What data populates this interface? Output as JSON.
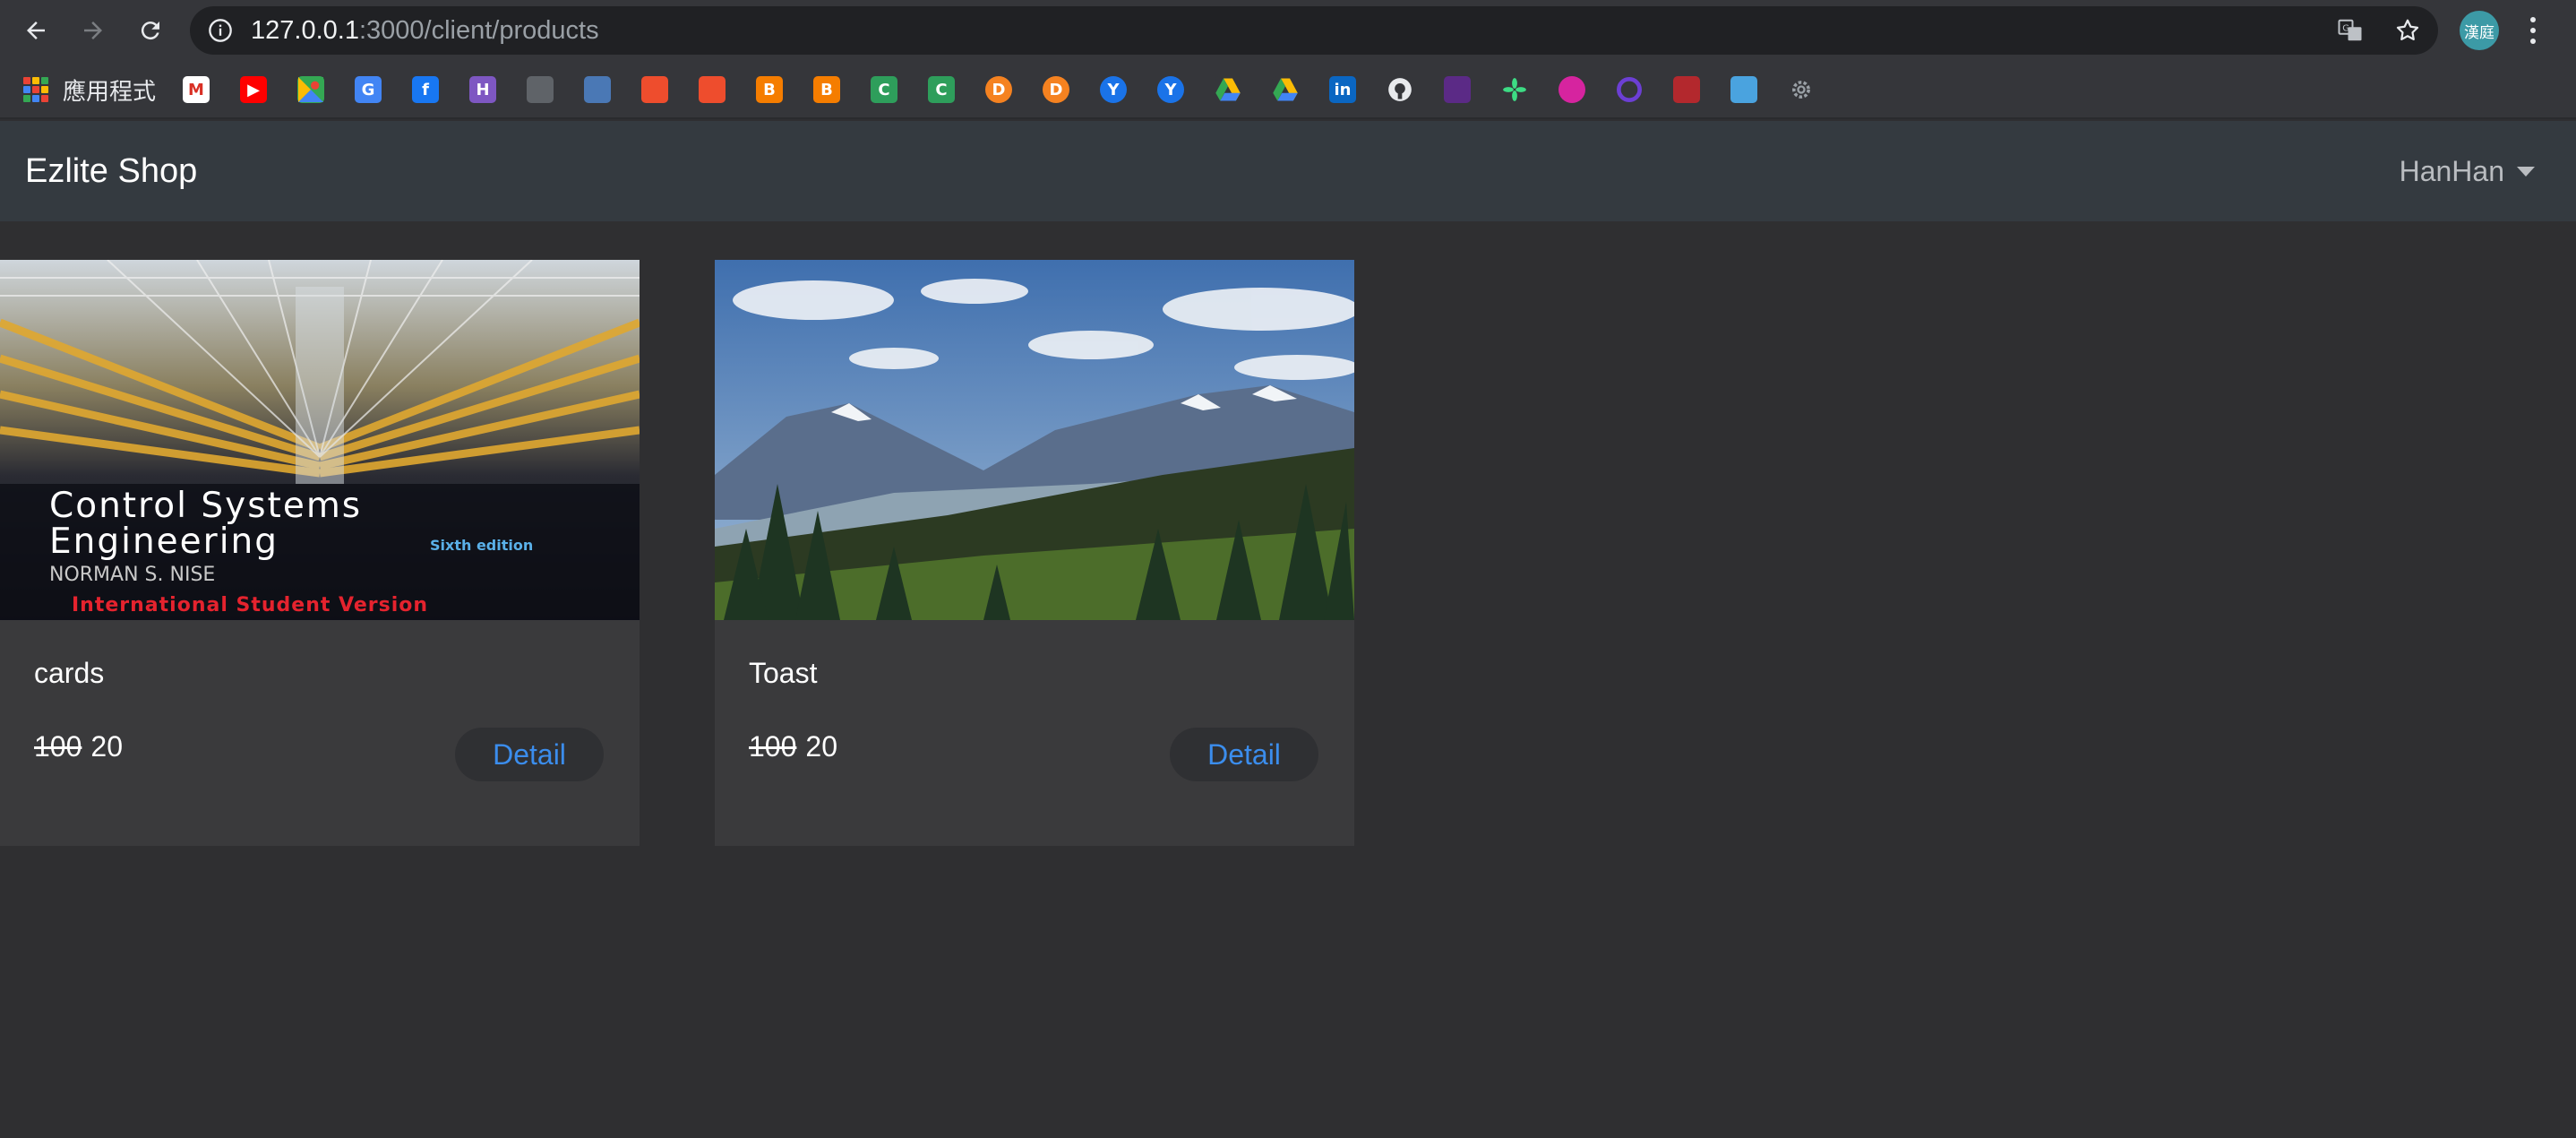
{
  "browser": {
    "url_host": "127.0.0.1",
    "url_path": ":3000/client/products",
    "profile_initials": "漢庭",
    "apps_label": "應用程式",
    "bookmarks": [
      {
        "icon": "gmail-icon",
        "color": "#ffffff",
        "letter": "M",
        "fg": "#d93025"
      },
      {
        "icon": "youtube-icon",
        "color": "#ff0000",
        "letter": "▶",
        "fg": "#ffffff"
      },
      {
        "icon": "google-maps-icon",
        "color": "#34a853",
        "letter": "",
        "fg": "#ffffff"
      },
      {
        "icon": "google-translate-icon",
        "color": "#4285f4",
        "letter": "G",
        "fg": "#ffffff"
      },
      {
        "icon": "facebook-icon",
        "color": "#1877f2",
        "letter": "f",
        "fg": "#ffffff"
      },
      {
        "icon": "hackmd-icon",
        "color": "#7e57c2",
        "letter": "H",
        "fg": "#ffffff"
      },
      {
        "icon": "tool-icon",
        "color": "#5f6368",
        "letter": "",
        "fg": "#ffffff"
      },
      {
        "icon": "blocked-icon",
        "color": "#4a78b5",
        "letter": "",
        "fg": "#ffffff"
      },
      {
        "icon": "shopee-icon",
        "color": "#ee4d2d",
        "letter": "",
        "fg": "#ffffff"
      },
      {
        "icon": "shopee-icon",
        "color": "#ee4d2d",
        "letter": "",
        "fg": "#ffffff"
      },
      {
        "icon": "blogger-icon",
        "color": "#f57d00",
        "letter": "B",
        "fg": "#ffffff"
      },
      {
        "icon": "blogger-icon",
        "color": "#f57d00",
        "letter": "B",
        "fg": "#ffffff"
      },
      {
        "icon": "c-icon",
        "color": "#2e9e5b",
        "letter": "C",
        "fg": "#ffffff"
      },
      {
        "icon": "c-icon",
        "color": "#2e9e5b",
        "letter": "C",
        "fg": "#ffffff"
      },
      {
        "icon": "orange-round-icon",
        "color": "#f58220",
        "letter": "D",
        "fg": "#ffffff"
      },
      {
        "icon": "orange-round-icon",
        "color": "#f58220",
        "letter": "D",
        "fg": "#ffffff"
      },
      {
        "icon": "blue-round-icon",
        "color": "#1a73e8",
        "letter": "Y",
        "fg": "#ffffff"
      },
      {
        "icon": "blue-round-icon",
        "color": "#1a73e8",
        "letter": "Y",
        "fg": "#ffffff"
      },
      {
        "icon": "google-drive-icon",
        "color": "#35363a",
        "letter": "",
        "fg": "#ffffff"
      },
      {
        "icon": "google-drive-icon",
        "color": "#35363a",
        "letter": "",
        "fg": "#ffffff"
      },
      {
        "icon": "linkedin-icon",
        "color": "#0a66c2",
        "letter": "in",
        "fg": "#ffffff"
      },
      {
        "icon": "github-icon",
        "color": "#35363a",
        "letter": "",
        "fg": "#ffffff"
      },
      {
        "icon": "purple-app-icon",
        "color": "#5b2a86",
        "letter": "",
        "fg": "#ffffff"
      },
      {
        "icon": "green-star-icon",
        "color": "#35363a",
        "letter": "",
        "fg": "#ffffff"
      },
      {
        "icon": "instagram-icon",
        "color": "#d6249f",
        "letter": "",
        "fg": "#ffffff"
      },
      {
        "icon": "purple-swirl-icon",
        "color": "#35363a",
        "letter": "",
        "fg": "#ffffff"
      },
      {
        "icon": "red-app-icon",
        "color": "#b3282d",
        "letter": "",
        "fg": "#ffffff"
      },
      {
        "icon": "blue-app-icon",
        "color": "#4aa3df",
        "letter": "",
        "fg": "#ffffff"
      },
      {
        "icon": "gear-icon",
        "color": "#35363a",
        "letter": "",
        "fg": "#ffffff"
      }
    ]
  },
  "app": {
    "brand": "Ezlite Shop",
    "user": "HanHan",
    "products": [
      {
        "title": "cards",
        "old_price": "100",
        "price": "20",
        "detail_label": "Detail",
        "image": "book-cover-image",
        "cover_title_1": "Control Systems",
        "cover_title_2": "Engineering",
        "cover_edition": "Sixth edition",
        "cover_author": "NORMAN S. NISE",
        "cover_banner": "International Student Version"
      },
      {
        "title": "Toast",
        "old_price": "100",
        "price": "20",
        "detail_label": "Detail",
        "image": "mountain-landscape-image"
      }
    ]
  }
}
